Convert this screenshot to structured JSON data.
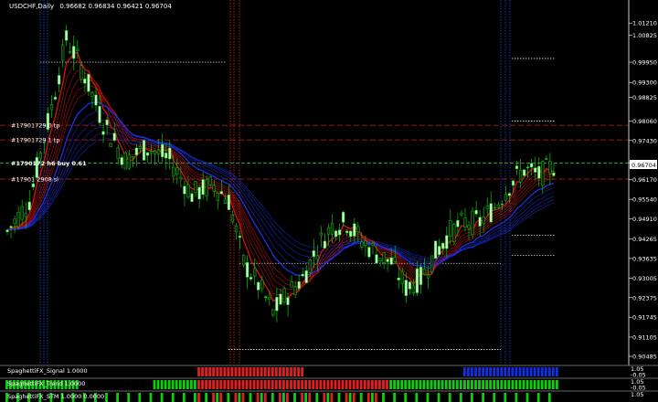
{
  "window": {
    "symbol_title": "USDCHF,Daily",
    "ohlc_text": "0.96682 0.96834 0.96421 0.96704"
  },
  "price_axis": {
    "min": 0.9031,
    "max": 1.0154,
    "ticks": [
      "1.01210",
      "1.00825",
      "0.99950",
      "0.99300",
      "0.98825",
      "0.98060",
      "0.97430",
      "0.96704",
      "0.96170",
      "0.95540",
      "0.94910",
      "0.94265",
      "0.93635",
      "0.93005",
      "0.92375",
      "0.91745",
      "0.91105",
      "0.90485"
    ],
    "current_price": "0.96704"
  },
  "orders": [
    {
      "label": "#17901729 0 tp",
      "price": 0.9792
    },
    {
      "label": "#17901729 1 tp",
      "price": 0.9745
    },
    {
      "label": "#1790172 h6 buy 0.61",
      "price": 0.967
    },
    {
      "label": "#17901 2908 sl",
      "price": 0.9619
    }
  ],
  "chart_data": {
    "type": "candlestick",
    "series_name": "USDCHF,Daily",
    "overlays": [
      "SpaghettiFX moving average ribbon (red/blue)"
    ],
    "last_bar": {
      "open": 0.96682,
      "high": 0.96834,
      "low": 0.96421,
      "close": 0.96704
    }
  },
  "subwindows": [
    {
      "label": "SpaghettiFX_Signal 1.0000",
      "scale_top": "1.05",
      "scale_bottom": "-0.05"
    },
    {
      "label": "SpaghettiFX_Trend 1.0000",
      "scale_top": "1.05",
      "scale_bottom": "-0.05"
    },
    {
      "label": "SpaghettiFX_STM 1.0000 0.0000",
      "scale_top": "1.05",
      "scale_bottom": ""
    }
  ],
  "colors": {
    "background": "#000000",
    "bull_candle": "#c8f0c8",
    "bear_candle": "#1a1a1a",
    "wick": "#00cc00",
    "ribbon_red": "#e01010",
    "ribbon_blue": "#2030e0",
    "order_line": "#cc2020",
    "entry_line": "#33cc33",
    "signal_red": "#e02020",
    "signal_blue": "#1030e0",
    "signal_green": "#10cc10"
  }
}
